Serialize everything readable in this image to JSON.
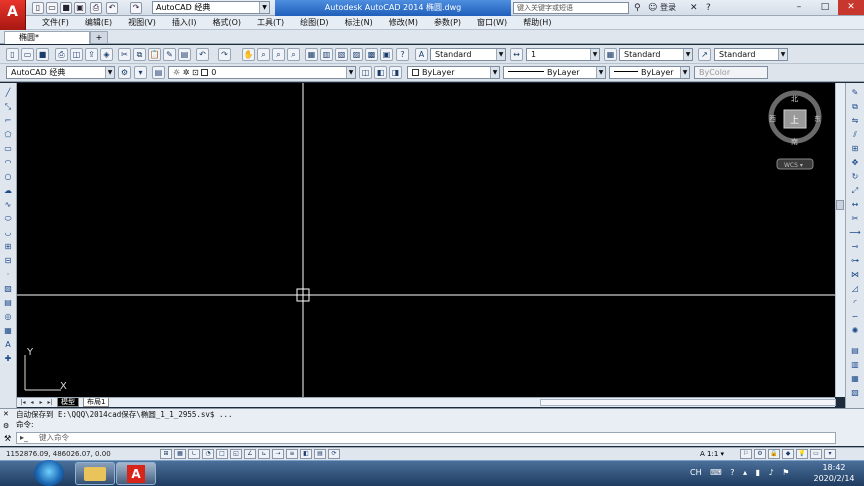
{
  "title_bar": {
    "logo": "A",
    "workspace": "AutoCAD 经典",
    "window_title": "Autodesk AutoCAD 2014    椭圆.dwg",
    "search_placeholder": "键入关键字或短语",
    "login": "登录"
  },
  "menu": [
    "文件(F)",
    "编辑(E)",
    "视图(V)",
    "插入(I)",
    "格式(O)",
    "工具(T)",
    "绘图(D)",
    "标注(N)",
    "修改(M)",
    "参数(P)",
    "窗口(W)",
    "帮助(H)"
  ],
  "doc_tab": {
    "label": "椭圆*",
    "close": "×"
  },
  "toolbar1": {
    "text_style": "Standard",
    "dim_scale": "1",
    "dim_style": "Standard",
    "table_style": "Standard"
  },
  "toolbar2": {
    "workspace": "AutoCAD 经典",
    "layer": "0",
    "color": "ByLayer",
    "linetype": "ByLayer",
    "lineweight": "ByLayer",
    "plotstyle": "ByColor"
  },
  "viewcube": {
    "n": "北",
    "s": "南",
    "e": "东",
    "w": "西",
    "face": "上",
    "wcs": "WCS ▾"
  },
  "ucs": {
    "x": "X",
    "y": "Y"
  },
  "layout_tabs": {
    "model": "模型",
    "layout1": "布局1"
  },
  "command": {
    "history1": "自动保存到 E:\\QQQ\\2014cad保存\\椭圆_1_1_2955.sv$ ...",
    "history2": "命令:",
    "input_placeholder": "键入命令"
  },
  "status": {
    "coords": "1152876.09, 486026.07, 0.00",
    "scale": "A 1:1 ▾"
  },
  "taskbar": {
    "lang": "CH",
    "time": "18:42",
    "date": "2020/2/14"
  },
  "colors": {
    "canvas": "#000000",
    "crosshair": "#ffffff",
    "title_active": "#1f5fba",
    "taskbar": "#1f3c60"
  }
}
